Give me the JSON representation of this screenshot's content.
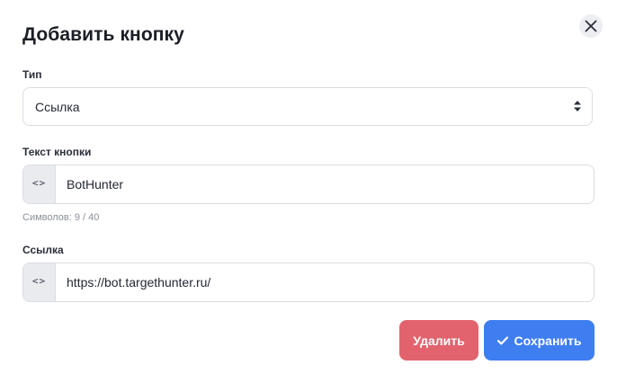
{
  "dialog": {
    "title": "Добавить кнопку",
    "close_icon": "close-icon"
  },
  "type_field": {
    "label": "Тип",
    "selected": "Ссылка",
    "icon": "select-arrows-icon"
  },
  "button_text_field": {
    "label": "Текст кнопки",
    "value": "BotHunter",
    "addon_icon": "code-icon",
    "addon_glyph": "<>",
    "hint": "Символов: 9 / 40"
  },
  "link_field": {
    "label": "Ссылка",
    "value": "https://bot.targethunter.ru/",
    "addon_icon": "code-icon",
    "addon_glyph": "<>"
  },
  "actions": {
    "delete_label": "Удалить",
    "save_label": "Сохранить",
    "save_icon": "check-icon"
  },
  "colors": {
    "delete": "#e2636e",
    "save": "#3f7ef0"
  }
}
